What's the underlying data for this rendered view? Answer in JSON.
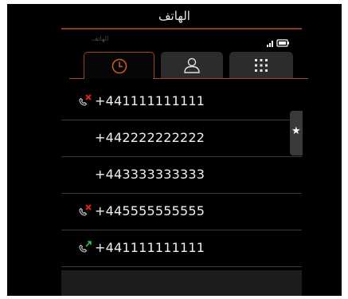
{
  "window": {
    "title": "الهاتف"
  },
  "status": {
    "label": "الهاتف"
  },
  "tabs": [
    {
      "id": "recents",
      "icon": "clock-icon",
      "active": true
    },
    {
      "id": "contacts",
      "icon": "person-icon",
      "active": false
    },
    {
      "id": "keypad",
      "icon": "dialpad-icon",
      "active": false
    }
  ],
  "calls": [
    {
      "number": "+441111111111",
      "type": "missed",
      "icon": "missed-call-icon"
    },
    {
      "number": "+442222222222",
      "type": "none",
      "icon": ""
    },
    {
      "number": "+443333333333",
      "type": "none",
      "icon": ""
    },
    {
      "number": "+445555555555",
      "type": "missed",
      "icon": "missed-call-icon"
    },
    {
      "number": "+441111111111",
      "type": "outgoing",
      "icon": "outgoing-call-icon"
    }
  ],
  "favorites": {
    "glyph": "★"
  },
  "colors": {
    "accent": "#a0461e",
    "missed": "#e02020",
    "outgoing": "#2fbf4a",
    "background": "#000000"
  }
}
